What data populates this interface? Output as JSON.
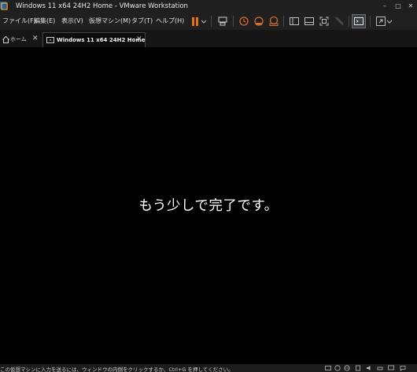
{
  "window": {
    "title": "Windows 11 x64 24H2 Home - VMware Workstation",
    "minimize_glyph": "–",
    "maximize_glyph": "□",
    "close_glyph": "✕"
  },
  "menu": {
    "items": [
      {
        "label": "ファイル(F)"
      },
      {
        "label": "編集(E)"
      },
      {
        "label": "表示(V)"
      },
      {
        "label": "仮想マシン(M)"
      },
      {
        "label": "タブ(T)"
      },
      {
        "label": "ヘルプ(H)"
      }
    ]
  },
  "toolbar": {
    "icons": [
      "pause-icon",
      "dropdown-arrow-icon",
      "send-keys-icon",
      "snapshot-icon",
      "revert-snapshot-icon",
      "snapshot-manager-icon",
      "sidebar-toggle-icon",
      "thumbnail-bar-icon",
      "full-screen-icon",
      "unity-icon",
      "console-view-icon",
      "stretch-view-icon"
    ],
    "accent_color": "#e8701a"
  },
  "tabs": [
    {
      "label": "ホーム",
      "close": "✕"
    },
    {
      "label": "Windows 11 x64 24H2 Home",
      "close": "✕"
    }
  ],
  "vm": {
    "message": "もう少しで完了です。"
  },
  "status": {
    "text": "この仮想マシンに入力を送るには、ウィンドウの内側をクリックするか、Ctrl+G を押してください。",
    "icons": [
      "hard-disk-icon",
      "cd-rom-icon",
      "network-icon",
      "usb-icon",
      "sound-icon",
      "printer-icon",
      "display-icon",
      "message-icon"
    ]
  }
}
